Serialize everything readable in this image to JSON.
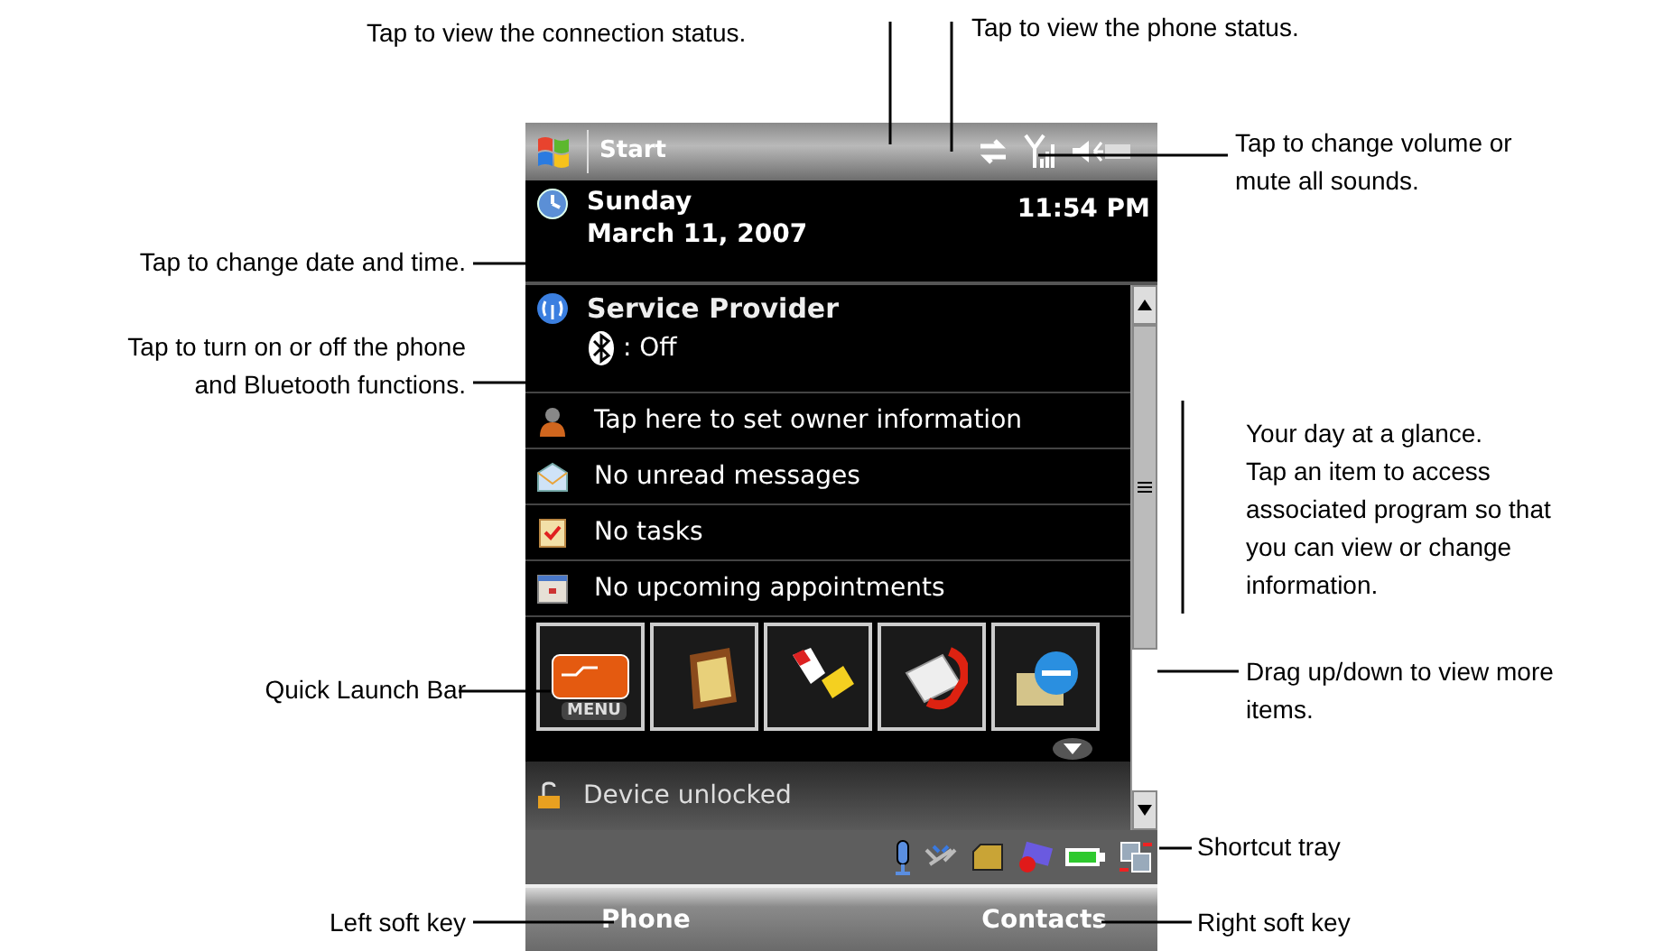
{
  "top_callouts": [
    {
      "text": "Tap to view the connection status."
    },
    {
      "text": "Tap to view the phone status."
    }
  ],
  "left_callouts": [
    {
      "text": "Tap to change date and time."
    },
    {
      "text": "Tap to turn on or off the phone\nand Bluetooth functions."
    },
    {
      "text": "Quick Launch Bar"
    },
    {
      "text": "Left soft key"
    }
  ],
  "right_callouts": [
    {
      "text": "Tap to change volume or\nmute all sounds."
    },
    {
      "text": "Your day at a glance.\nTap an item to access\nassociated program so that\nyou can view or change\ninformation."
    },
    {
      "text": "Drag up/down to view more\nitems."
    },
    {
      "text": "Shortcut tray"
    },
    {
      "text": "Right soft key"
    }
  ],
  "phone": {
    "title_bar": {
      "start": "Start"
    },
    "today": {
      "day": "Sunday",
      "date": "March 11, 2007",
      "time": "11:54 PM"
    },
    "service": {
      "name": "Service Provider",
      "bluetooth": ": Off"
    },
    "items": [
      {
        "kind": "owner",
        "text": "Tap here to set owner information"
      },
      {
        "kind": "messages",
        "text": "No unread messages"
      },
      {
        "kind": "tasks",
        "text": "No tasks"
      },
      {
        "kind": "calendar",
        "text": "No upcoming appointments"
      }
    ],
    "quick_launch": {
      "menu_label": "MENU"
    },
    "device_status": "Device unlocked",
    "soft_keys": {
      "left": "Phone",
      "right": "Contacts"
    }
  }
}
